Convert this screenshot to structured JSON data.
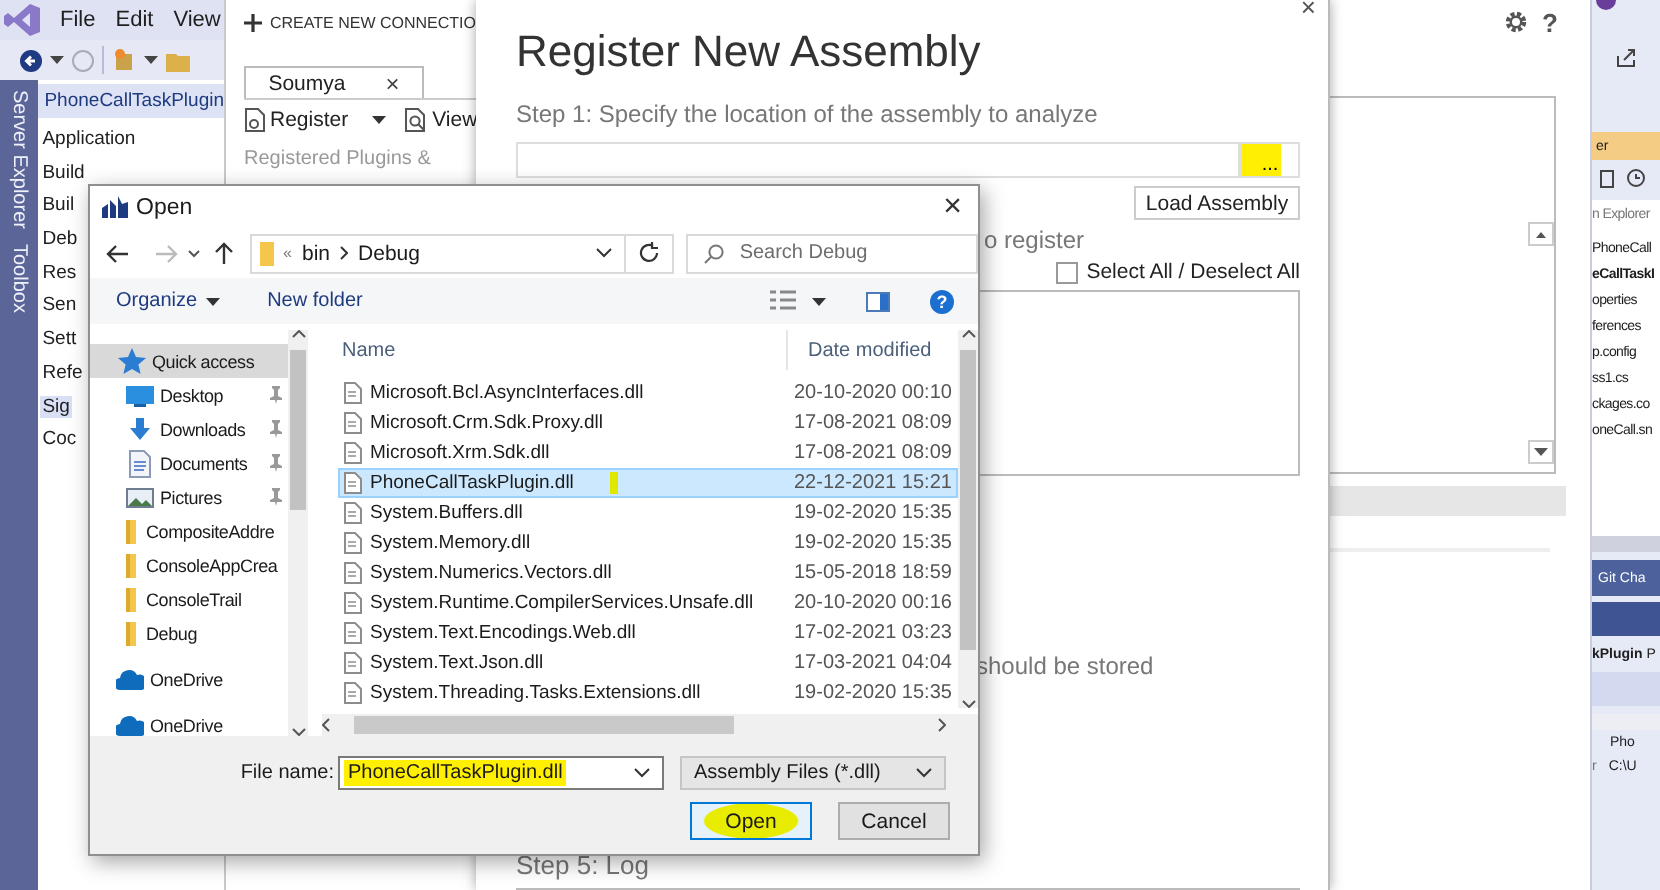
{
  "vs": {
    "menu": [
      "File",
      "Edit",
      "View"
    ],
    "side_tabs": [
      "Server Explorer",
      "Toolbox"
    ]
  },
  "project_properties": {
    "title": "PhoneCallTaskPlugin",
    "pages": [
      {
        "label": "Application",
        "selected": false
      },
      {
        "label": "Build",
        "selected": false
      },
      {
        "label": "Buil",
        "selected": false
      },
      {
        "label": "Deb",
        "selected": false
      },
      {
        "label": "Res",
        "selected": false
      },
      {
        "label": "Sen",
        "selected": false
      },
      {
        "label": "Sett",
        "selected": false
      },
      {
        "label": "Refe",
        "selected": false
      },
      {
        "label": "Sig",
        "selected": true
      },
      {
        "label": "Coc",
        "selected": false
      }
    ]
  },
  "plugin_tool": {
    "new_connection": "CREATE NEW CONNECTIO",
    "tab": {
      "label": "Soumya",
      "close": "×"
    },
    "toolbar": [
      {
        "kind": "register",
        "label": "Register"
      },
      {
        "kind": "view",
        "label": "View"
      }
    ],
    "tree_heading": "Registered Plugins &",
    "help": "?"
  },
  "register_dialog": {
    "close": "×",
    "title": "Register New Assembly",
    "step1": "Step 1: Specify the location of the assembly to analyze",
    "browse": {
      "label": "...",
      "highlighted": true
    },
    "load_button": "Load Assembly",
    "step2_tail": "o register",
    "select_all": {
      "label": "Select All / Deselect All",
      "checked": false
    },
    "step4_tail": "should be stored",
    "step5": "Step 5: Log"
  },
  "open_dialog": {
    "title": "Open",
    "close": "×",
    "path_overflow": "«",
    "path": [
      "bin",
      "Debug"
    ],
    "search": {
      "placeholder": "Search Debug"
    },
    "organize": "Organize",
    "new_folder": "New folder",
    "help": "?",
    "nav": [
      {
        "label": "Quick access",
        "kind": "quick-access",
        "selected": true,
        "pinned": false
      },
      {
        "label": "Desktop",
        "kind": "desktop",
        "selected": false,
        "pinned": true
      },
      {
        "label": "Downloads",
        "kind": "downloads",
        "selected": false,
        "pinned": true
      },
      {
        "label": "Documents",
        "kind": "documents",
        "selected": false,
        "pinned": true
      },
      {
        "label": "Pictures",
        "kind": "pictures",
        "selected": false,
        "pinned": true
      },
      {
        "label": "CompositeAddre",
        "kind": "folder",
        "selected": false,
        "pinned": false
      },
      {
        "label": "ConsoleAppCrea",
        "kind": "folder",
        "selected": false,
        "pinned": false
      },
      {
        "label": "ConsoleTrail",
        "kind": "folder",
        "selected": false,
        "pinned": false
      },
      {
        "label": "Debug",
        "kind": "folder",
        "selected": false,
        "pinned": false
      },
      {
        "label": "OneDrive",
        "kind": "onedrive",
        "selected": false,
        "pinned": false
      },
      {
        "label": "OneDrive",
        "kind": "onedrive",
        "selected": false,
        "pinned": false
      }
    ],
    "columns": [
      "Name",
      "Date modified"
    ],
    "files": [
      {
        "name": "Microsoft.Bcl.AsyncInterfaces.dll",
        "date": "20-10-2020 00:10",
        "selected": false,
        "highlighted": false
      },
      {
        "name": "Microsoft.Crm.Sdk.Proxy.dll",
        "date": "17-08-2021 08:09",
        "selected": false,
        "highlighted": false
      },
      {
        "name": "Microsoft.Xrm.Sdk.dll",
        "date": "17-08-2021 08:09",
        "selected": false,
        "highlighted": false
      },
      {
        "name": "PhoneCallTaskPlugin.dll",
        "date": "22-12-2021 15:21",
        "selected": true,
        "highlighted": true
      },
      {
        "name": "System.Buffers.dll",
        "date": "19-02-2020 15:35",
        "selected": false,
        "highlighted": false
      },
      {
        "name": "System.Memory.dll",
        "date": "19-02-2020 15:35",
        "selected": false,
        "highlighted": false
      },
      {
        "name": "System.Numerics.Vectors.dll",
        "date": "15-05-2018 18:59",
        "selected": false,
        "highlighted": false
      },
      {
        "name": "System.Runtime.CompilerServices.Unsafe.dll",
        "date": "20-10-2020 00:16",
        "selected": false,
        "highlighted": false
      },
      {
        "name": "System.Text.Encodings.Web.dll",
        "date": "17-02-2021 03:23",
        "selected": false,
        "highlighted": false
      },
      {
        "name": "System.Text.Json.dll",
        "date": "17-03-2021 04:04",
        "selected": false,
        "highlighted": false
      },
      {
        "name": "System.Threading.Tasks.Extensions.dll",
        "date": "19-02-2020 15:35",
        "selected": false,
        "highlighted": false
      }
    ],
    "file_name": {
      "label": "File name:",
      "value": "PhoneCallTaskPlugin.dll",
      "highlighted": true
    },
    "file_type": "Assembly Files (*.dll)",
    "buttons": [
      {
        "label": "Open",
        "kind": "primary",
        "highlighted": true
      },
      {
        "label": "Cancel",
        "kind": "secondary",
        "highlighted": false
      }
    ]
  },
  "solution_explorer": {
    "title": "er",
    "search": {
      "placeholder": "n Explorer"
    },
    "items": [
      {
        "label": "PhoneCall",
        "bold": false
      },
      {
        "label": "eCallTaskI",
        "bold": true
      },
      {
        "label": "operties",
        "bold": false
      },
      {
        "label": "ferences",
        "bold": false
      },
      {
        "label": "p.config",
        "bold": false
      },
      {
        "label": "ss1.cs",
        "bold": false
      },
      {
        "label": "ckages.co",
        "bold": false
      },
      {
        "label": "oneCall.sn",
        "bold": false
      }
    ],
    "bottom_tab": "Git Cha",
    "project_line": "**kPlugin** P",
    "properties": [
      {
        "value": "Pho"
      },
      {
        "label": "r",
        "value": "C:\\U"
      }
    ]
  }
}
